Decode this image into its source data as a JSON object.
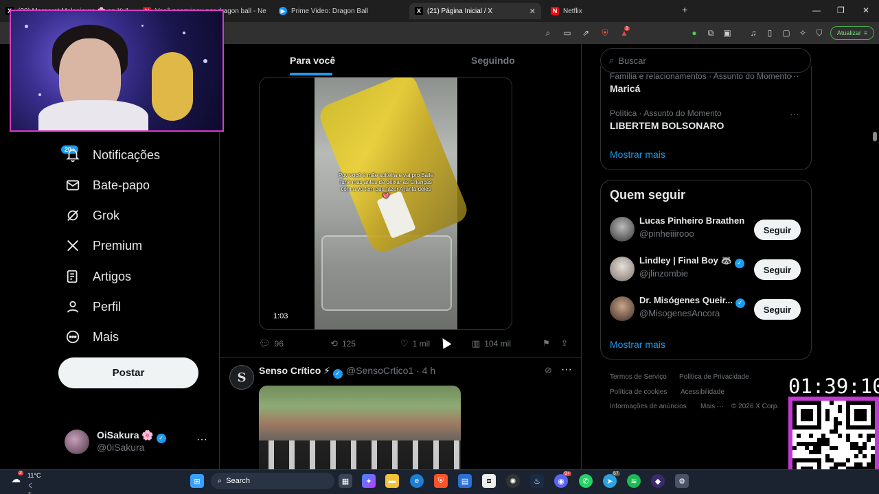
{
  "browser": {
    "tabs": [
      {
        "label": "(20) Margaret Melanieura 🌸 on X: \"",
        "icon": "x-icon"
      },
      {
        "label": "Você pesquisou por dragon ball - Ne",
        "icon": "netflix-icon"
      },
      {
        "label": "Prime Video: Dragon Ball",
        "icon": "prime-icon"
      },
      {
        "label": "(21) Página Inicial / X",
        "icon": "x-icon"
      },
      {
        "label": "Netflix",
        "icon": "netflix-icon"
      }
    ],
    "new_tab": "+",
    "update_label": "Atualizar",
    "brave_badge": "1"
  },
  "nav": {
    "notif_badge": "20+",
    "items": [
      {
        "label": "Notificações",
        "icon": "bell-icon"
      },
      {
        "label": "Bate-papo",
        "icon": "mail-icon"
      },
      {
        "label": "Grok",
        "icon": "grok-icon"
      },
      {
        "label": "Premium",
        "icon": "x-logo-icon"
      },
      {
        "label": "Artigos",
        "icon": "article-icon"
      },
      {
        "label": "Perfil",
        "icon": "person-icon"
      },
      {
        "label": "Mais",
        "icon": "more-circle-icon"
      }
    ],
    "post_label": "Postar"
  },
  "profile": {
    "name": "OiSakura 🌸",
    "handle": "@0iSakura",
    "more": "···"
  },
  "feed": {
    "tab_for_you": "Para você",
    "tab_following": "Seguindo",
    "post1": {
      "caption": "Pov você é mãe solteira e vai pro Baile funk mas antes de deixar as Crianças com a vó tem que fazer A janta deles💖",
      "duration": "1:03",
      "replies": "96",
      "reposts": "125",
      "likes": "1 mil",
      "views": "104 mil"
    },
    "post2": {
      "avatar_letter": "S",
      "name": "Senso Crítico ⚡",
      "handle": "@SensoCrtico1 · 4 h"
    }
  },
  "sidebar": {
    "search_placeholder": "Buscar",
    "trends": [
      {
        "meta": "Família e relacionamentos · Assunto do Momento",
        "title": "Maricá"
      },
      {
        "meta": "Política · Assunto do Momento",
        "title": "LIBERTEM BOLSONARO"
      }
    ],
    "show_more": "Mostrar mais",
    "who_to_follow_title": "Quem seguir",
    "follow": [
      {
        "name": "Lucas Pinheiro Braathen",
        "handle": "@pinheiiirooo",
        "verified": false,
        "button": "Seguir"
      },
      {
        "name": "Lindley | Final Boy 🦝",
        "handle": "@jlinzombie",
        "verified": true,
        "button": "Seguir"
      },
      {
        "name": "Dr. Misógenes Queir...",
        "handle": "@MisogenesAncora",
        "verified": true,
        "button": "Seguir"
      }
    ],
    "show_more_follow": "Mostrar mais",
    "footer": [
      "Termos de Serviço",
      "Política de Privacidade",
      "Política de cookies",
      "Acessibilidade",
      "Informações de anúncios",
      "Mais ···",
      "© 2026 X Corp."
    ]
  },
  "overlay": {
    "clock": "01:39:10"
  },
  "taskbar": {
    "temp": "11°C",
    "weather_sub": "くもり",
    "weather_badge": "2",
    "search_label": "Search",
    "discord_badge": "9+",
    "telegram_badge": "57"
  },
  "colors": {
    "accent": "#1d9bf0",
    "background": "#000000",
    "text": "#e7e9ea",
    "muted": "#71767b",
    "stream_frame": "#d63cc8"
  }
}
